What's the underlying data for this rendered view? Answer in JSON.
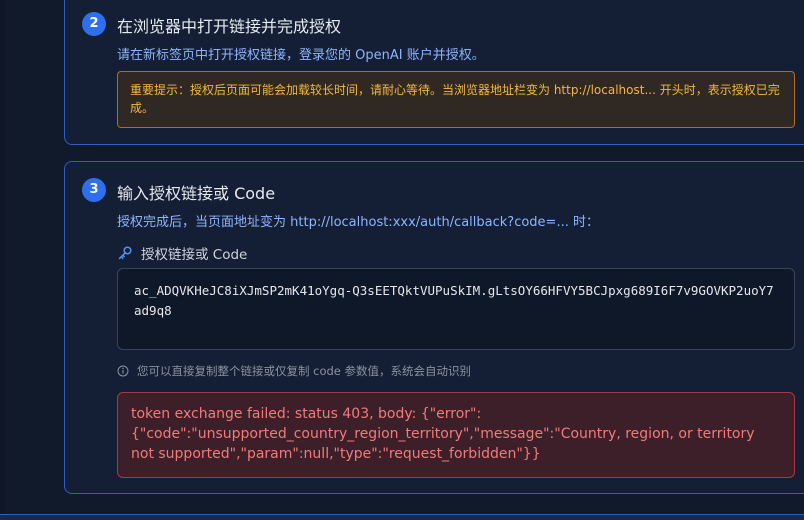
{
  "step2": {
    "number": "2",
    "title": "在浏览器中打开链接并完成授权",
    "description": "请在新标签页中打开授权链接，登录您的 OpenAI 账户并授权。",
    "warning": "重要提示：授权后页面可能会加载较长时间，请耐心等待。当浏览器地址栏变为 http://localhost... 开头时，表示授权已完成。"
  },
  "step3": {
    "number": "3",
    "title": "输入授权链接或 Code",
    "description": "授权完成后，当页面地址变为 http://localhost:xxx/auth/callback?code=... 时：",
    "field_label": "授权链接或 Code",
    "field_value": "ac_ADQVKHeJC8iXJmSP2mK41oYgq-Q3sEETQktVUPuSkIM.gLtsOY66HFVY5BCJpxg689I6F7v9GOVKP2uoY7ad9q8",
    "hint": "您可以直接复制整个链接或仅复制 code 参数值，系统会自动识别",
    "error": "token exchange failed: status 403, body: {\"error\":{\"code\":\"unsupported_country_region_territory\",\"message\":\"Country, region, or territory not supported\",\"param\":null,\"type\":\"request_forbidden\"}}"
  },
  "colors": {
    "accent": "#2f6fed",
    "card_border": "#2f5ec4",
    "warning_text": "#f4b740",
    "error_text": "#f47a7a"
  },
  "icons": {
    "field_label": "key-icon",
    "hint": "info-icon"
  }
}
